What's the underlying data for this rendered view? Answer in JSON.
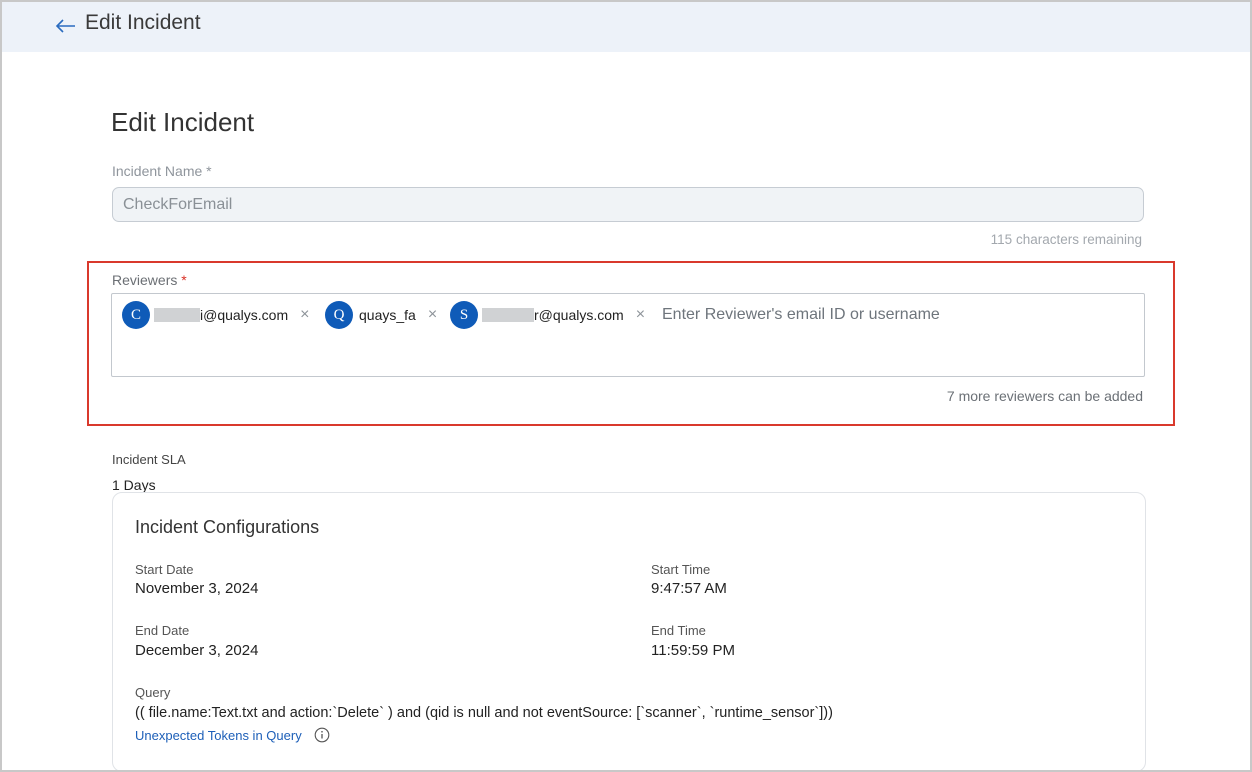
{
  "header": {
    "title": "Edit Incident",
    "back_icon": "arrow-left-icon"
  },
  "page": {
    "title": "Edit Incident"
  },
  "incident_name": {
    "label": "Incident Name",
    "required_mark": "*",
    "value": "CheckForEmail",
    "chars_remaining": "115 characters remaining"
  },
  "reviewers": {
    "label": "Reviewers",
    "required_mark": "*",
    "chips": [
      {
        "initial": "C",
        "text": "i@qualys.com",
        "redacted": true
      },
      {
        "initial": "Q",
        "text": "quays_fa",
        "redacted": false
      },
      {
        "initial": "S",
        "text": "r@qualys.com",
        "redacted": true
      }
    ],
    "remove_glyph": "×",
    "placeholder": "Enter Reviewer's email ID or username",
    "more_text": "7 more reviewers can be added",
    "avatar_color": "#0f5bb8",
    "highlight_color": "#d9392c"
  },
  "sla": {
    "label": "Incident SLA",
    "value": "1 Days"
  },
  "configurations": {
    "title": "Incident Configurations",
    "start_date_label": "Start Date",
    "start_date": "November 3, 2024",
    "start_time_label": "Start Time",
    "start_time": "9:47:57 AM",
    "end_date_label": "End Date",
    "end_date": "December 3, 2024",
    "end_time_label": "End Time",
    "end_time": "11:59:59 PM",
    "query_label": "Query",
    "query": "(( file.name:Text.txt and action:`Delete` ) and (qid is null and not eventSource: [`scanner`, `runtime_sensor`]))",
    "query_link": "Unexpected Tokens in Query",
    "info_icon": "info-circle-icon"
  }
}
